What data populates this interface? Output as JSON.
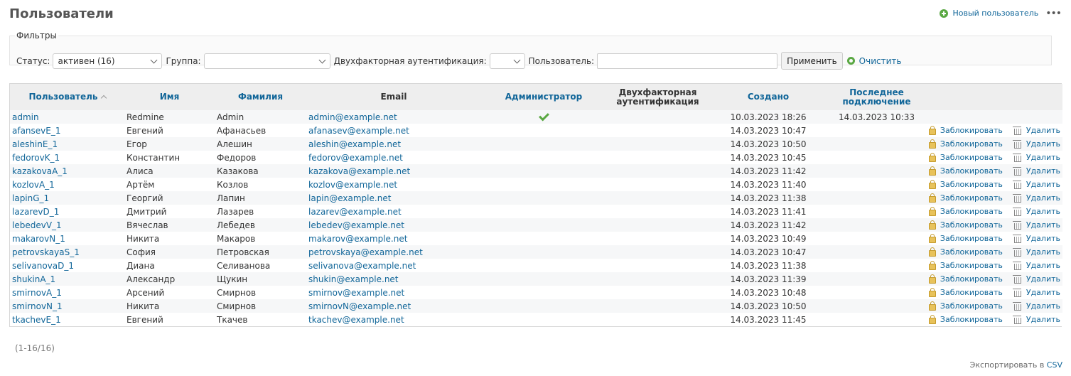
{
  "page": {
    "title": "Пользователи"
  },
  "contextual": {
    "new_user": "Новый пользователь",
    "more": "•••"
  },
  "filters": {
    "legend": "Фильтры",
    "status_label": "Статус:",
    "status_value": "активен (16)",
    "group_label": "Группа:",
    "group_value": "",
    "twofa_label": "Двухфакторная аутентификация:",
    "twofa_value": "",
    "user_label": "Пользователь:",
    "user_value": "",
    "apply": "Применить",
    "clear": "Очистить"
  },
  "table": {
    "headers": {
      "login": "Пользователь",
      "firstname": "Имя",
      "lastname": "Фамилия",
      "email": "Email",
      "admin": "Администратор",
      "twofa": "Двухфакторная аутентификация",
      "created": "Создано",
      "last_login": "Последнее подключение"
    },
    "rows": [
      {
        "login": "admin",
        "firstname": "Redmine",
        "lastname": "Admin",
        "email": "admin@example.net",
        "admin": true,
        "created": "10.03.2023 18:26",
        "last_login": "14.03.2023 10:33",
        "actions": false
      },
      {
        "login": "afansevE_1",
        "firstname": "Евгений",
        "lastname": "Афанасьев",
        "email": "afanasev@example.net",
        "admin": false,
        "created": "14.03.2023 10:47",
        "last_login": "",
        "actions": true
      },
      {
        "login": "aleshinE_1",
        "firstname": "Егор",
        "lastname": "Алешин",
        "email": "aleshin@example.net",
        "admin": false,
        "created": "14.03.2023 10:50",
        "last_login": "",
        "actions": true
      },
      {
        "login": "fedorovK_1",
        "firstname": "Константин",
        "lastname": "Федоров",
        "email": "fedorov@example.net",
        "admin": false,
        "created": "14.03.2023 10:45",
        "last_login": "",
        "actions": true
      },
      {
        "login": "kazakovaA_1",
        "firstname": "Алиса",
        "lastname": "Казакова",
        "email": "kazakova@example.net",
        "admin": false,
        "created": "14.03.2023 11:42",
        "last_login": "",
        "actions": true
      },
      {
        "login": "kozlovA_1",
        "firstname": "Артём",
        "lastname": "Козлов",
        "email": "kozlov@example.net",
        "admin": false,
        "created": "14.03.2023 11:40",
        "last_login": "",
        "actions": true
      },
      {
        "login": "lapinG_1",
        "firstname": "Георгий",
        "lastname": "Лапин",
        "email": "lapin@example.net",
        "admin": false,
        "created": "14.03.2023 11:38",
        "last_login": "",
        "actions": true
      },
      {
        "login": "lazarevD_1",
        "firstname": "Дмитрий",
        "lastname": "Лазарев",
        "email": "lazarev@example.net",
        "admin": false,
        "created": "14.03.2023 11:41",
        "last_login": "",
        "actions": true
      },
      {
        "login": "lebedevV_1",
        "firstname": "Вячеслав",
        "lastname": "Лебедев",
        "email": "lebedev@example.net",
        "admin": false,
        "created": "14.03.2023 11:42",
        "last_login": "",
        "actions": true
      },
      {
        "login": "makarovN_1",
        "firstname": "Никита",
        "lastname": "Макаров",
        "email": "makarov@example.net",
        "admin": false,
        "created": "14.03.2023 10:49",
        "last_login": "",
        "actions": true
      },
      {
        "login": "petrovskayaS_1",
        "firstname": "София",
        "lastname": "Петровская",
        "email": "petrovskaya@example.net",
        "admin": false,
        "created": "14.03.2023 10:47",
        "last_login": "",
        "actions": true
      },
      {
        "login": "selivanovaD_1",
        "firstname": "Диана",
        "lastname": "Селиванова",
        "email": "selivanova@example.net",
        "admin": false,
        "created": "14.03.2023 11:38",
        "last_login": "",
        "actions": true
      },
      {
        "login": "shukinA_1",
        "firstname": "Александр",
        "lastname": "Щукин",
        "email": "shukin@example.net",
        "admin": false,
        "created": "14.03.2023 11:39",
        "last_login": "",
        "actions": true
      },
      {
        "login": "smirnovA_1",
        "firstname": "Арсений",
        "lastname": "Смирнов",
        "email": "smirnov@example.net",
        "admin": false,
        "created": "14.03.2023 10:48",
        "last_login": "",
        "actions": true
      },
      {
        "login": "smirnovN_1",
        "firstname": "Никита",
        "lastname": "Смирнов",
        "email": "smirnovN@example.net",
        "admin": false,
        "created": "14.03.2023 10:50",
        "last_login": "",
        "actions": true
      },
      {
        "login": "tkachevE_1",
        "firstname": "Евгений",
        "lastname": "Ткачев",
        "email": "tkachev@example.net",
        "admin": false,
        "created": "14.03.2023 11:45",
        "last_login": "",
        "actions": true
      }
    ],
    "row_actions": {
      "lock": "Заблокировать",
      "delete": "Удалить"
    }
  },
  "pagination": {
    "text": "(1-16/16)"
  },
  "export": {
    "label": "Экспортировать в",
    "format": "CSV"
  },
  "colors": {
    "link": "#116699",
    "accent_green": "#5aa843",
    "header_bg": "#eeeeee"
  }
}
